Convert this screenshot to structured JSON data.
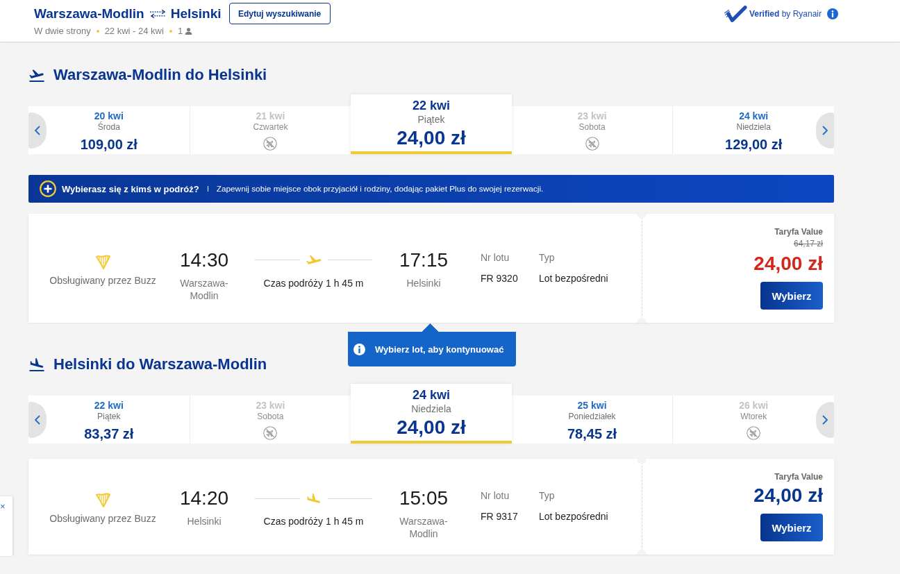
{
  "header": {
    "origin": "Warszawa-Modlin",
    "destination": "Helsinki",
    "edit_button": "Edytuj wyszukiwanie",
    "trip_type": "W dwie strony",
    "dates": "22 kwi - 24 kwi",
    "passengers": "1",
    "verified": "**Verified** by Ryanair"
  },
  "sections": [
    {
      "kind": "outbound",
      "title": "Warszawa-Modlin do Helsinki",
      "dates": [
        {
          "date": "20 kwi",
          "day": "Środa",
          "price": "109,00 zł",
          "available": true,
          "selected": false
        },
        {
          "date": "21 kwi",
          "day": "Czwartek",
          "available": false,
          "selected": false
        },
        {
          "date": "22 kwi",
          "day": "Piątek",
          "price": "24,00 zł",
          "available": true,
          "selected": true
        },
        {
          "date": "23 kwi",
          "day": "Sobota",
          "available": false,
          "selected": false
        },
        {
          "date": "24 kwi",
          "day": "Niedziela",
          "price": "129,00 zł",
          "available": true,
          "selected": false
        }
      ],
      "promo": {
        "title": "Wybierasz się z kimś w podróż?",
        "text": "Zapewnij sobie miejsce obok przyjaciół i rodziny, dodając pakiet Plus do swojej rezerwacji."
      },
      "flights": [
        {
          "operator": "Obsługiwany przez Buzz",
          "departure_time": "14:30",
          "departure_airport": "Warszawa-Modlin",
          "duration": "Czas podróży 1 h 45 m",
          "arrival_time": "17:15",
          "arrival_airport": "Helsinki",
          "flight_number_label": "Nr lotu",
          "flight_number": "FR 9320",
          "type_label": "Typ",
          "type": "Lot bezpośredni",
          "fare": "Taryfa Value",
          "old_price": "64,17 zł",
          "price": "24,00 zł",
          "discounted": true,
          "button": "Wybierz"
        }
      ],
      "tooltip": {
        "text": "Wybierz lot, aby kontynuować"
      }
    },
    {
      "kind": "inbound",
      "title": "Helsinki do Warszawa-Modlin",
      "dates": [
        {
          "date": "22 kwi",
          "day": "Piątek",
          "price": "83,37 zł",
          "available": true,
          "selected": false
        },
        {
          "date": "23 kwi",
          "day": "Sobota",
          "available": false,
          "selected": false
        },
        {
          "date": "24 kwi",
          "day": "Niedziela",
          "price": "24,00 zł",
          "available": true,
          "selected": true
        },
        {
          "date": "25 kwi",
          "day": "Poniedziałek",
          "price": "78,45 zł",
          "available": true,
          "selected": false
        },
        {
          "date": "26 kwi",
          "day": "Wtorek",
          "available": false,
          "selected": false
        }
      ],
      "flights": [
        {
          "operator": "Obsługiwany przez Buzz",
          "departure_time": "14:20",
          "departure_airport": "Helsinki",
          "duration": "Czas podróży 1 h 45 m",
          "arrival_time": "15:05",
          "arrival_airport": "Warszawa-Modlin",
          "flight_number_label": "Nr lotu",
          "flight_number": "FR 9317",
          "type_label": "Typ",
          "type": "Lot bezpośredni",
          "fare": "Taryfa Value",
          "price": "24,00 zł",
          "discounted": false,
          "button": "Wybierz"
        }
      ]
    }
  ],
  "side_panel": {
    "close": "×"
  }
}
